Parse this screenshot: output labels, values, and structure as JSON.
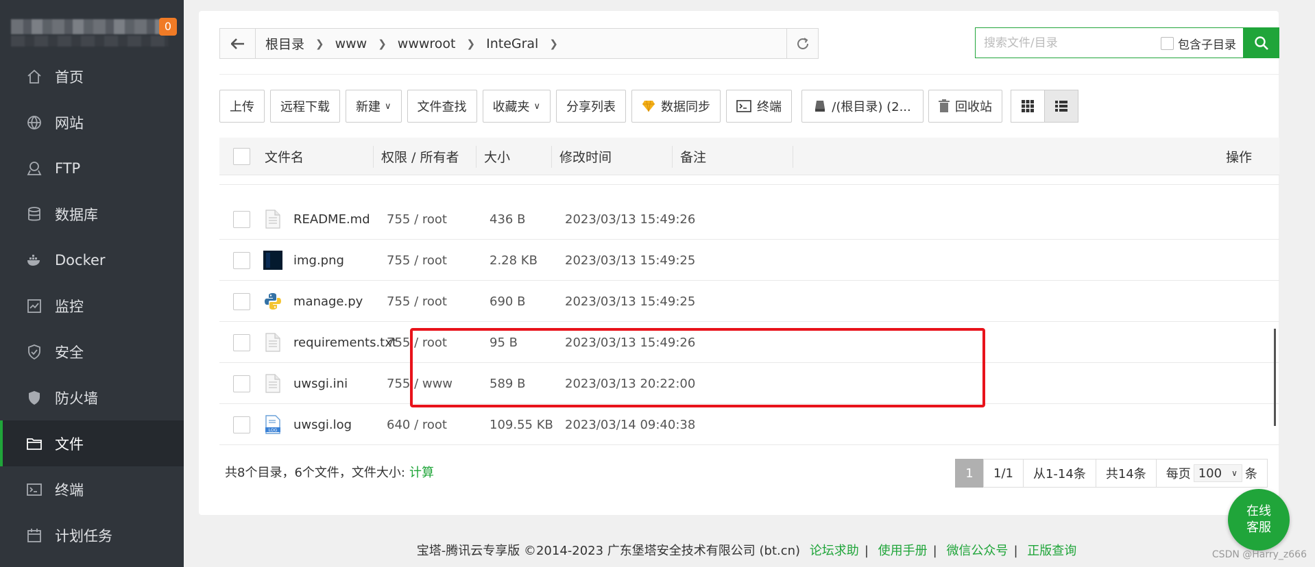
{
  "sidebar": {
    "badge": "0",
    "items": [
      {
        "label": "首页",
        "icon": "home-icon"
      },
      {
        "label": "网站",
        "icon": "globe-icon"
      },
      {
        "label": "FTP",
        "icon": "ftp-icon"
      },
      {
        "label": "数据库",
        "icon": "database-icon"
      },
      {
        "label": "Docker",
        "icon": "docker-icon"
      },
      {
        "label": "监控",
        "icon": "monitor-icon"
      },
      {
        "label": "安全",
        "icon": "shield-icon"
      },
      {
        "label": "防火墙",
        "icon": "firewall-icon"
      },
      {
        "label": "文件",
        "icon": "folder-icon",
        "active": true
      },
      {
        "label": "终端",
        "icon": "terminal-icon"
      },
      {
        "label": "计划任务",
        "icon": "calendar-icon"
      }
    ]
  },
  "breadcrumb": [
    "根目录",
    "www",
    "wwwroot",
    "InteGral"
  ],
  "search": {
    "placeholder": "搜索文件/目录",
    "include_sub_label": "包含子目录"
  },
  "toolbar": {
    "upload": "上传",
    "remote_download": "远程下载",
    "new": "新建",
    "find": "文件查找",
    "favorites": "收藏夹",
    "share_list": "分享列表",
    "sync": "数据同步",
    "terminal": "终端",
    "disk": "/(根目录) (2...",
    "recycle": "回收站"
  },
  "table": {
    "headers": {
      "name": "文件名",
      "perm": "权限 / 所有者",
      "size": "大小",
      "mtime": "修改时间",
      "note": "备注",
      "ops": "操作"
    },
    "rows": [
      {
        "name": "README.md",
        "perm": "755 / root",
        "size": "436 B",
        "mtime": "2023/03/13 15:49:26",
        "icon": "file-icon"
      },
      {
        "name": "img.png",
        "perm": "755 / root",
        "size": "2.28 KB",
        "mtime": "2023/03/13 15:49:25",
        "icon": "image-thumbnail-icon"
      },
      {
        "name": "manage.py",
        "perm": "755 / root",
        "size": "690 B",
        "mtime": "2023/03/13 15:49:25",
        "icon": "python-icon"
      },
      {
        "name": "requirements.txt",
        "perm": "755 / root",
        "size": "95 B",
        "mtime": "2023/03/13 15:49:26",
        "icon": "file-icon"
      },
      {
        "name": "uwsgi.ini",
        "perm": "755 / www",
        "size": "589 B",
        "mtime": "2023/03/13 20:22:00",
        "icon": "file-icon"
      },
      {
        "name": "uwsgi.log",
        "perm": "640 / root",
        "size": "109.55 KB",
        "mtime": "2023/03/14 09:40:38",
        "icon": "log-file-icon"
      }
    ]
  },
  "summary": {
    "text": "共8个目录，6个文件，文件大小:",
    "calc": "计算"
  },
  "pager": {
    "current": "1",
    "pages": "1/1",
    "range": "从1-14条",
    "total": "共14条",
    "per_page_label": "每页",
    "per_page": "100",
    "unit": "条"
  },
  "footer": {
    "copyright": "宝塔-腾讯云专享版 ©2014-2023 广东堡塔安全技术有限公司 (bt.cn)",
    "links": [
      "论坛求助",
      "使用手册",
      "微信公众号",
      "正版查询"
    ]
  },
  "chat": {
    "line1": "在线",
    "line2": "客服"
  },
  "watermark": "CSDN @Harry_z666",
  "colors": {
    "accent": "#20a53a",
    "sidebar": "#30353b",
    "highlight": "#e8131b"
  }
}
